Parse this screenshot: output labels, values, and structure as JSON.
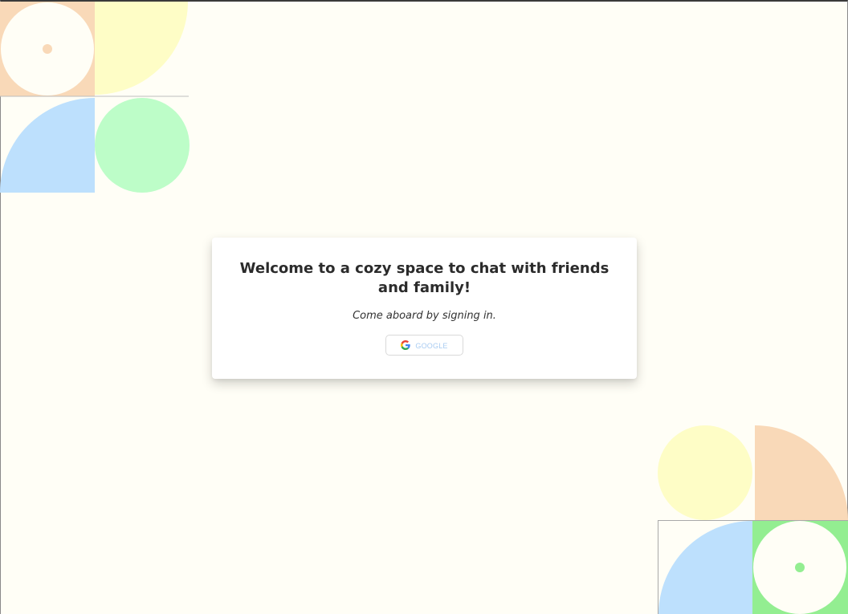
{
  "card": {
    "title": "Welcome to a cozy space to chat with friends and family!",
    "subtitle": "Come aboard by signing in.",
    "google_button": {
      "label": "GOOGLE",
      "icon": "google-g-icon"
    }
  },
  "colors": {
    "background": "#fffef6",
    "peach": "#f9d9b8",
    "yellow": "#fefdc6",
    "blue": "#bde0fd",
    "mint": "#bdfdc8",
    "green": "#93ee91",
    "cream": "#fffef6"
  }
}
